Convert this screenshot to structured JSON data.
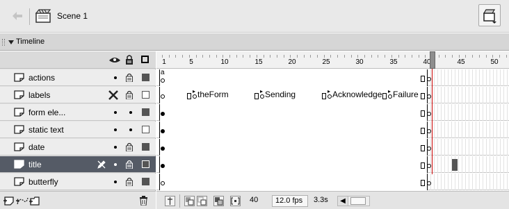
{
  "scene": {
    "label": "Scene 1"
  },
  "timeline": {
    "title": "Timeline",
    "ruler": [
      "1",
      "5",
      "10",
      "15",
      "20",
      "25",
      "30",
      "35",
      "40",
      "45",
      "50"
    ],
    "layers": [
      {
        "name": "actions",
        "marker_a": "a"
      },
      {
        "name": "labels",
        "frame_labels": [
          "theForm",
          "Sending",
          "Acknowledge",
          "Failure"
        ]
      },
      {
        "name": "form ele..."
      },
      {
        "name": "static text"
      },
      {
        "name": "date"
      },
      {
        "name": "title",
        "selected": true
      },
      {
        "name": "butterfly"
      }
    ],
    "footer": {
      "current_frame": "40",
      "fps": "12.0 fps",
      "time": "3.3s"
    }
  },
  "icons": [
    "back-arrow-icon",
    "scene-icon",
    "edit-scene-icon",
    "eye-icon",
    "lock-icon",
    "outline-icon",
    "layer-icon",
    "pencil-icon",
    "add-layer-icon",
    "add-motion-guide-icon",
    "insert-folder-icon",
    "trash-icon"
  ],
  "colors": {
    "selected_row": "#555b66",
    "playhead": "#cc0000"
  }
}
